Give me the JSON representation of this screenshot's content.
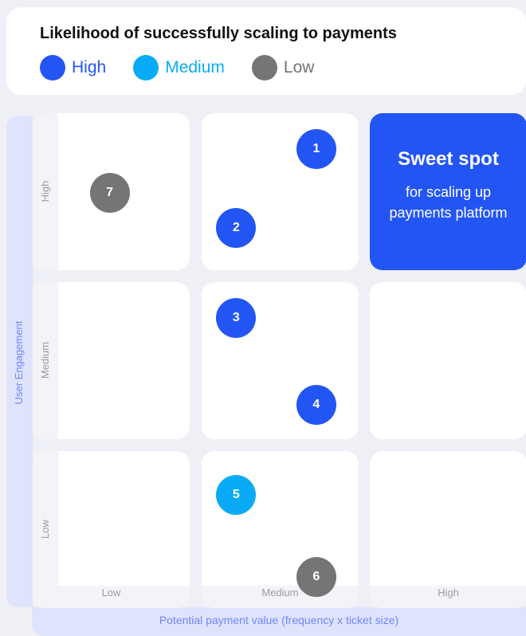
{
  "legend": {
    "title": "Likelihood of successfully scaling to payments",
    "items": [
      {
        "label": "High",
        "color": "#2355f5"
      },
      {
        "label": "Medium",
        "color": "#0aabf6"
      },
      {
        "label": "Low",
        "color": "#757575"
      }
    ]
  },
  "chart_data": {
    "type": "scatter",
    "xlabel": "Potential payment value (frequency x ticket size)",
    "ylabel": "User Engagement",
    "x_categories": [
      "Low",
      "Medium",
      "High"
    ],
    "y_categories": [
      "Low",
      "Medium",
      "High"
    ],
    "highlight": {
      "cell": {
        "x": "High",
        "y": "High"
      },
      "title": "Sweet spot",
      "text": "for scaling up payments platform"
    },
    "points": [
      {
        "label": "1",
        "x": 1.73,
        "y": 2.77,
        "likelihood": "High"
      },
      {
        "label": "2",
        "x": 1.22,
        "y": 2.27,
        "likelihood": "High"
      },
      {
        "label": "3",
        "x": 1.22,
        "y": 1.77,
        "likelihood": "High"
      },
      {
        "label": "4",
        "x": 1.73,
        "y": 1.22,
        "likelihood": "High"
      },
      {
        "label": "5",
        "x": 1.22,
        "y": 0.72,
        "likelihood": "Medium"
      },
      {
        "label": "6",
        "x": 1.73,
        "y": 0.2,
        "likelihood": "Low"
      },
      {
        "label": "7",
        "x": 0.49,
        "y": 2.49,
        "likelihood": "Low"
      }
    ]
  }
}
